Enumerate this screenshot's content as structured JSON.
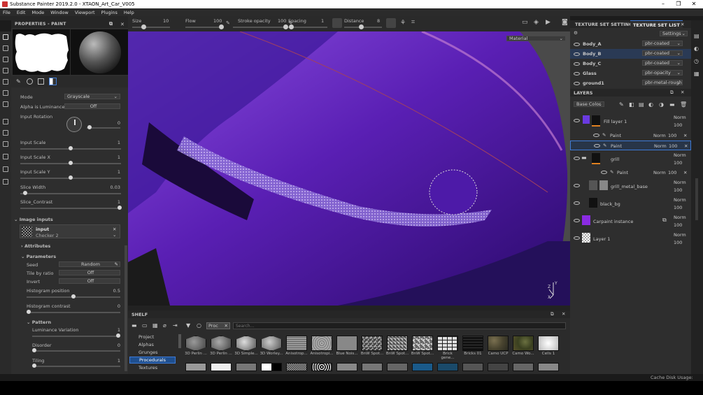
{
  "window": {
    "title": "Substance Painter 2019.2.0 - XTAON_Art_Car_V005"
  },
  "menu": [
    "File",
    "Edit",
    "Mode",
    "Window",
    "Viewport",
    "Plugins",
    "Help"
  ],
  "toolbar": {
    "size_label": "Size",
    "size_value": "10",
    "flow_label": "Flow",
    "flow_value": "100",
    "stroke_label": "Stroke opacity",
    "stroke_value": "100",
    "spacing_label": "Spacing",
    "spacing_value": "1",
    "distance_label": "Distance",
    "distance_value": "8"
  },
  "properties": {
    "header": "PROPERTIES - PAINT",
    "mode_label": "Mode",
    "mode_value": "Grayscale",
    "alpha_label": "Alpha is Luminance",
    "alpha_value": "Off",
    "rotation_label": "Input Rotation",
    "rotation_value": "0",
    "input_scale_label": "Input Scale",
    "input_scale_value": "1",
    "input_scale_x_label": "Input Scale X",
    "input_scale_x_value": "1",
    "input_scale_y_label": "Input Scale Y",
    "input_scale_y_value": "1",
    "slice_width_label": "Slice Width",
    "slice_width_value": "0.03",
    "slice_contrast_label": "Slice_Contrast",
    "slice_contrast_value": "1",
    "image_inputs_label": "Image inputs",
    "input_name": "input",
    "input_resource": "Checker 2",
    "attributes_label": "Attributes",
    "parameters_label": "Parameters",
    "seed_label": "Seed",
    "seed_value": "Random",
    "tile_ratio_label": "Tile by ratio",
    "tile_ratio_value": "Off",
    "invert_label": "Invert",
    "invert_value": "Off",
    "hist_pos_label": "Histogram position",
    "hist_pos_value": "0.5",
    "hist_con_label": "Histogram contrast",
    "hist_con_value": "0",
    "pattern_label": "Pattern",
    "lum_var_label": "Luminance Variation",
    "lum_var_value": "1",
    "disorder_label": "Disorder",
    "disorder_value": "0",
    "tiling_label": "Tiling",
    "tiling_value": "1"
  },
  "viewport": {
    "material_label": "Material"
  },
  "shelf": {
    "header": "SHELF",
    "filter_tag": "Proc",
    "search_placeholder": "Search...",
    "categories": [
      "Project",
      "Alphas",
      "Grunges",
      "Procedurals",
      "Textures"
    ],
    "selected_category": "Procedurals",
    "items": [
      "3D Perlin ...",
      "3D Perlin ...",
      "3D Simple...",
      "3D Worley...",
      "Anisotrop...",
      "Anisotropi...",
      "Blue Nois...",
      "BnW Spot...",
      "BnW Spot...",
      "BnW Spot...",
      "Brick gene...",
      "Bricks 01",
      "Camo UCP",
      "Camo Wo...",
      "Cells 1"
    ]
  },
  "texture_sets": {
    "tab_settings": "TEXTURE SET SETTINGS",
    "tab_list": "TEXTURE SET LIST",
    "settings_label": "Settings",
    "rows": [
      {
        "name": "Body_A",
        "shader": "pbr-coated"
      },
      {
        "name": "Body_B",
        "shader": "pbr-coated"
      },
      {
        "name": "Body_C",
        "shader": "pbr-coated"
      },
      {
        "name": "Glass",
        "shader": "pbr-opacity"
      },
      {
        "name": "ground1",
        "shader": "pbr-metal-rough"
      }
    ]
  },
  "layers": {
    "header": "LAYERS",
    "channel": "Base Color",
    "items": [
      {
        "name": "Fill layer 1",
        "blend": "Norm",
        "opacity": "100"
      },
      {
        "name": "Paint",
        "blend": "Norm",
        "opacity": "100"
      },
      {
        "name": "Paint",
        "blend": "Norm",
        "opacity": "100"
      },
      {
        "name": "grill",
        "blend": "Norm",
        "opacity": "100"
      },
      {
        "name": "Paint",
        "blend": "Norm",
        "opacity": "100"
      },
      {
        "name": "grill_metal_base",
        "blend": "Norm",
        "opacity": "100"
      },
      {
        "name": "black_bg",
        "blend": "Norm",
        "opacity": "100"
      },
      {
        "name": "Carpaint instance",
        "blend": "Norm",
        "opacity": "100"
      },
      {
        "name": "Layer 1",
        "blend": "Norm",
        "opacity": "100"
      }
    ]
  },
  "status": {
    "cache": "Cache Disk Usage:  10%"
  },
  "colors": {
    "accent": "#3d7ad6",
    "purple": "#6a24c8",
    "panel": "#2e2e2e"
  }
}
